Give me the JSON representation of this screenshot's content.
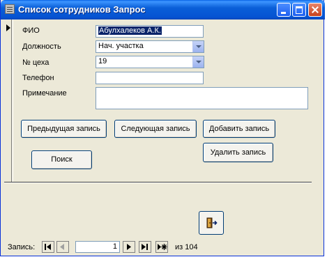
{
  "window": {
    "title": "Список сотрудников Запрос"
  },
  "form": {
    "fields": [
      {
        "label": "ФИО",
        "value": "Абулхалеков А.К."
      },
      {
        "label": "Должность",
        "value": "Нач. участка"
      },
      {
        "label": "№ цеха",
        "value": "19"
      },
      {
        "label": "Телефон",
        "value": ""
      },
      {
        "label": "Примечание",
        "value": ""
      }
    ],
    "buttons": {
      "prev": "Предыдущая запись",
      "next": "Следующая запись",
      "add": "Добавить запись",
      "delete": "Удалить запись",
      "search": "Поиск"
    }
  },
  "navigator": {
    "label": "Запись:",
    "current": "1",
    "of_text": "из  104"
  },
  "icons": {
    "exit": "exit-door-icon",
    "record_selector": "record-selector-arrow-icon"
  },
  "colors": {
    "titlebar": "#0a5fd8",
    "window_bg": "#ece9d8",
    "field_border": "#7f9db9",
    "selection": "#0a246a"
  }
}
